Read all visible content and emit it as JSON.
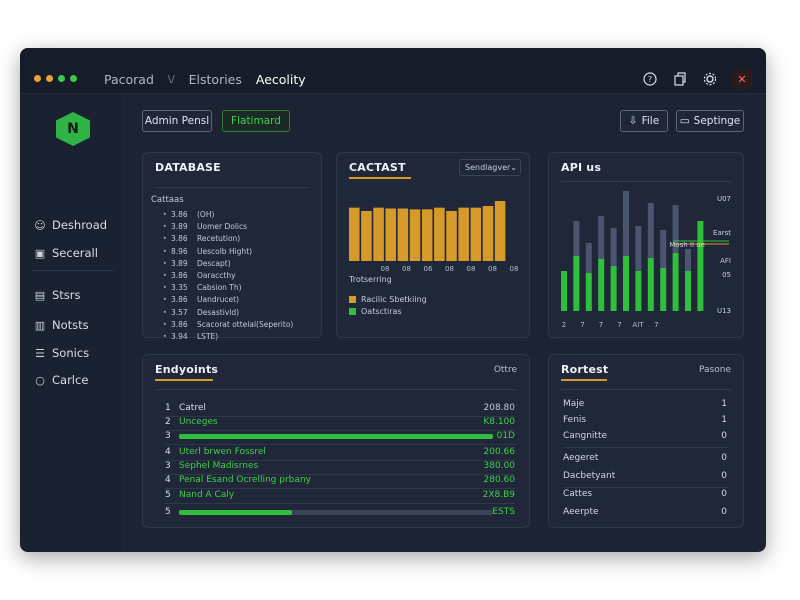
{
  "titlebar": {
    "dot_colors": [
      "#e8a33a",
      "#e8a33a",
      "#3ec94d",
      "#3ec94d"
    ],
    "nav": [
      "Pacorad",
      "Elstories",
      "Aecolity"
    ],
    "sep": "\\/",
    "icons": [
      "help-icon",
      "copy-icon",
      "settings-icon",
      "close-icon"
    ]
  },
  "sidebar": {
    "logo_glyph": "N",
    "items": [
      {
        "label": "Deshroad",
        "icon": "☺"
      },
      {
        "label": "Secerall",
        "icon": "▣"
      },
      {
        "label": "Stsrs",
        "icon": "▤"
      },
      {
        "label": "Notsts",
        "icon": "▥"
      },
      {
        "label": "Sonics",
        "icon": "☰"
      },
      {
        "label": "Carlce",
        "icon": "○"
      }
    ]
  },
  "toolbar": {
    "admin_label": "Admin Pensl",
    "dashboard_label": "Flatimard",
    "file_label": "File",
    "settings_label": "Septinge",
    "file_icon": "⇩",
    "settings_icon": "▭"
  },
  "database": {
    "title": "DATABASE",
    "subtitle": "Cattaas",
    "rows": [
      {
        "v": "3.86",
        "t": "(OH)"
      },
      {
        "v": "3.89",
        "t": "Uomer Dolics"
      },
      {
        "v": "3.86",
        "t": "Recetution)"
      },
      {
        "v": "8.96",
        "t": "Uescolb Hight)"
      },
      {
        "v": "3.89",
        "t": "Descapt)"
      },
      {
        "v": "3.86",
        "t": "Oaraccthy"
      },
      {
        "v": "3.35",
        "t": "Cabsion Th)"
      },
      {
        "v": "3.86",
        "t": "Uandrucet)"
      },
      {
        "v": "3.57",
        "t": "Desastivld)"
      },
      {
        "v": "3.86",
        "t": "Scacorat ottelal(Seperito)"
      },
      {
        "v": "3.94",
        "t": "LSTE)"
      }
    ]
  },
  "forecast": {
    "title": "CACTAST",
    "dropdown": "Sendlagver",
    "axis_caption": "Trotserring",
    "ticks": [
      "08",
      "08",
      "06",
      "08",
      "08",
      "08",
      "08"
    ],
    "legend": [
      {
        "label": "Racilic Sbetkiing",
        "color": "#d59a2a"
      },
      {
        "label": "Oatsctiras",
        "color": "#2fbf3c"
      }
    ]
  },
  "api": {
    "title": "API us",
    "right_labels": [
      "U07",
      "Earst",
      "Mosh II ue",
      "AFI",
      "05",
      "U13"
    ],
    "x_ticks": [
      "2",
      "7",
      "7",
      "7",
      "AIT",
      "7"
    ]
  },
  "endpoints": {
    "title": "Endyoints",
    "right": "Ottre",
    "rows": [
      {
        "n": "1",
        "name": "Catrel",
        "value": "208.80",
        "green": false
      },
      {
        "n": "2",
        "name": "Unceges",
        "value": "K8.100",
        "green": true
      },
      {
        "n": "3",
        "name": "",
        "value": "01D",
        "green": true,
        "bar": 1.0
      },
      {
        "n": "4",
        "name": "Uterl brwen Fossrel",
        "value": "200.66",
        "green": true
      },
      {
        "n": "3",
        "name": "Sephel Madisrnes",
        "value": "380.00",
        "green": true
      },
      {
        "n": "4",
        "name": "Penal Esand Ocrelling prbany",
        "value": "280.60",
        "green": true
      },
      {
        "n": "5",
        "name": "Nand A Caly",
        "value": "2X8.B9",
        "green": true
      },
      {
        "n": "5",
        "name": "",
        "value": "ESTS",
        "green": true,
        "bar": 0.36
      }
    ]
  },
  "report": {
    "title": "Rortest",
    "right": "Pasone",
    "rows": [
      {
        "name": "Maje",
        "value": "1"
      },
      {
        "name": "Fenis",
        "value": "1"
      },
      {
        "name": "Cangnitte",
        "value": "0"
      },
      {
        "name": "Aegeret",
        "value": "0"
      },
      {
        "name": "Dacbetyant",
        "value": "0"
      },
      {
        "name": "Cattes",
        "value": "0"
      },
      {
        "name": "Aeerpte",
        "value": "0"
      }
    ]
  },
  "chart_data": [
    {
      "type": "bar",
      "title": "CACTAST",
      "xlabel": "Trotserring",
      "categories": [
        "1",
        "2",
        "3",
        "4",
        "5",
        "6",
        "7",
        "8",
        "9",
        "10",
        "11",
        "12",
        "13"
      ],
      "series": [
        {
          "name": "Racilic Sbetkiing",
          "values": [
            64,
            60,
            64,
            63,
            63,
            62,
            62,
            64,
            60,
            64,
            64,
            66,
            72
          ]
        }
      ],
      "color": "#d59a2a",
      "ylim": [
        0,
        100
      ]
    },
    {
      "type": "bar",
      "title": "API us",
      "categories": [
        "1",
        "2",
        "3",
        "4",
        "5",
        "6",
        "7",
        "8",
        "9",
        "10",
        "11",
        "12"
      ],
      "series": [
        {
          "values": [
            40,
            55,
            38,
            52,
            45,
            55,
            40,
            53,
            43,
            58,
            40,
            90
          ],
          "color": "#2fbf3c"
        },
        {
          "values": [
            0,
            35,
            30,
            43,
            38,
            65,
            45,
            55,
            38,
            48,
            22,
            0
          ],
          "color": "#4a5670"
        }
      ],
      "ylim": [
        0,
        100
      ]
    }
  ]
}
